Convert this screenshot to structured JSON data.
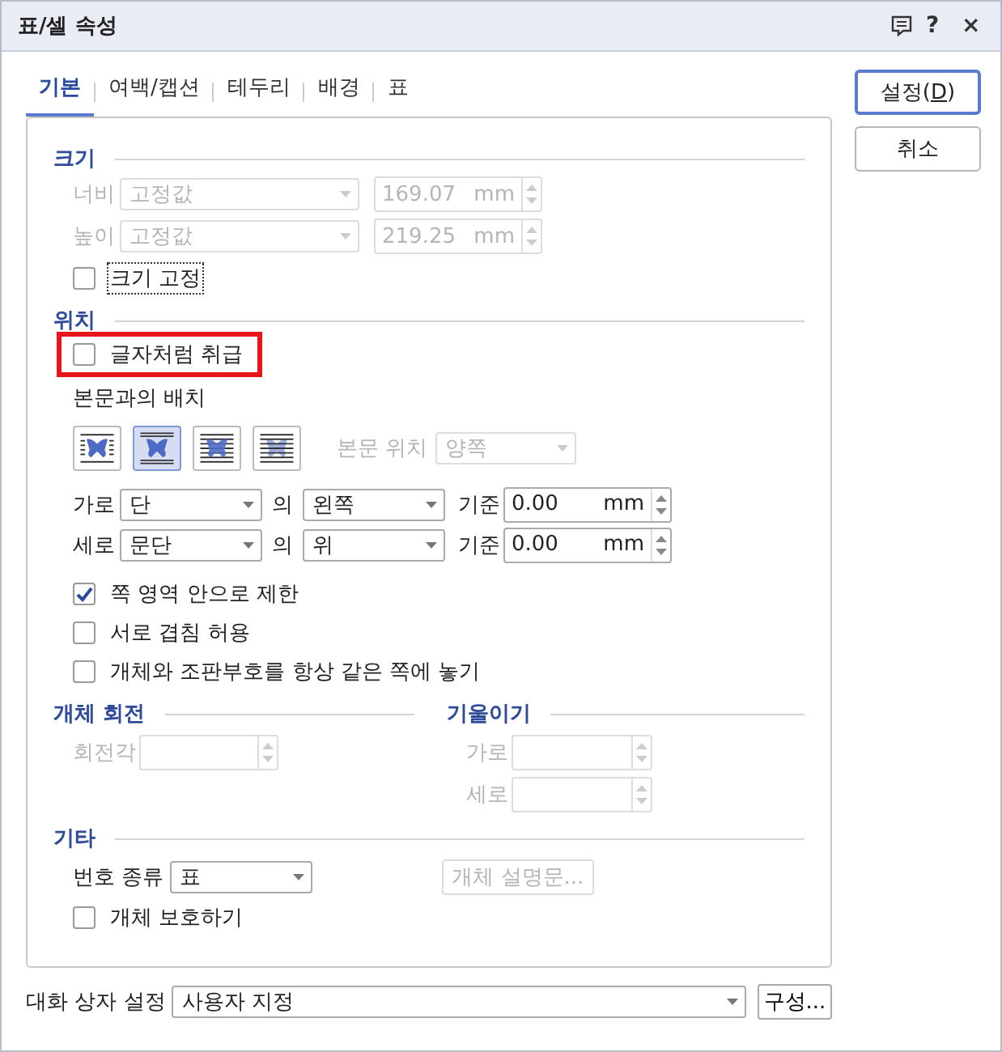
{
  "window": {
    "title": "표/셀 속성",
    "help": "?",
    "close": "×"
  },
  "tabs": [
    {
      "label": "기본",
      "selected": true
    },
    {
      "label": "여백/캡션",
      "selected": false
    },
    {
      "label": "테두리",
      "selected": false
    },
    {
      "label": "배경",
      "selected": false
    },
    {
      "label": "표",
      "selected": false
    }
  ],
  "buttons": [
    {
      "label_before": "설정(",
      "access_key": "D",
      "label_after": ")",
      "default": true
    },
    {
      "label_before": "취소",
      "default": false
    }
  ],
  "size": {
    "heading": "크기",
    "rows": [
      {
        "label": "너비",
        "mode": "고정값",
        "value": "169.07",
        "unit": "mm",
        "disabled": true
      },
      {
        "label": "높이",
        "mode": "고정값",
        "value": "219.25",
        "unit": "mm",
        "disabled": true
      }
    ],
    "lock": {
      "label": "크기 고정",
      "checked": false,
      "focused": true
    }
  },
  "position": {
    "heading": "위치",
    "treat_as_char": {
      "label": "글자처럼 취급",
      "checked": false,
      "highlighted": true
    },
    "wrap_label": "본문과의 배치",
    "wrap_options": [
      {
        "kind": "square",
        "selected": false
      },
      {
        "kind": "top-bottom",
        "selected": true
      },
      {
        "kind": "behind-text",
        "selected": false
      },
      {
        "kind": "in-front",
        "selected": false
      }
    ],
    "text_side": {
      "label": "본문 위치",
      "value": "양쪽",
      "disabled": true
    },
    "offsets": [
      {
        "label": "가로",
        "base": "단",
        "of": "의",
        "side": "왼쪽",
        "ref": "기준",
        "value": "0.00",
        "unit": "mm"
      },
      {
        "label": "세로",
        "base": "문단",
        "of": "의",
        "side": "위",
        "ref": "기준",
        "value": "0.00",
        "unit": "mm"
      }
    ],
    "options": [
      {
        "label": "쪽 영역 안으로 제한",
        "checked": true
      },
      {
        "label": "서로 겹침 허용",
        "checked": false
      },
      {
        "label": "개체와 조판부호를 항상 같은 쪽에 놓기",
        "checked": false
      }
    ]
  },
  "rotation": {
    "heading": "개체 회전",
    "label": "회전각",
    "disabled": true
  },
  "skew": {
    "heading": "기울이기",
    "rows": [
      {
        "label": "가로",
        "disabled": true
      },
      {
        "label": "세로",
        "disabled": true
      }
    ]
  },
  "misc": {
    "heading": "기타",
    "number_type": {
      "label": "번호 종류",
      "value": "표"
    },
    "description_button": {
      "label": "개체 설명문...",
      "disabled": true
    },
    "protect": {
      "label": "개체 보호하기",
      "checked": false
    }
  },
  "footer": {
    "label": "대화 상자 설정",
    "value": "사용자 지정",
    "button": "구성..."
  }
}
